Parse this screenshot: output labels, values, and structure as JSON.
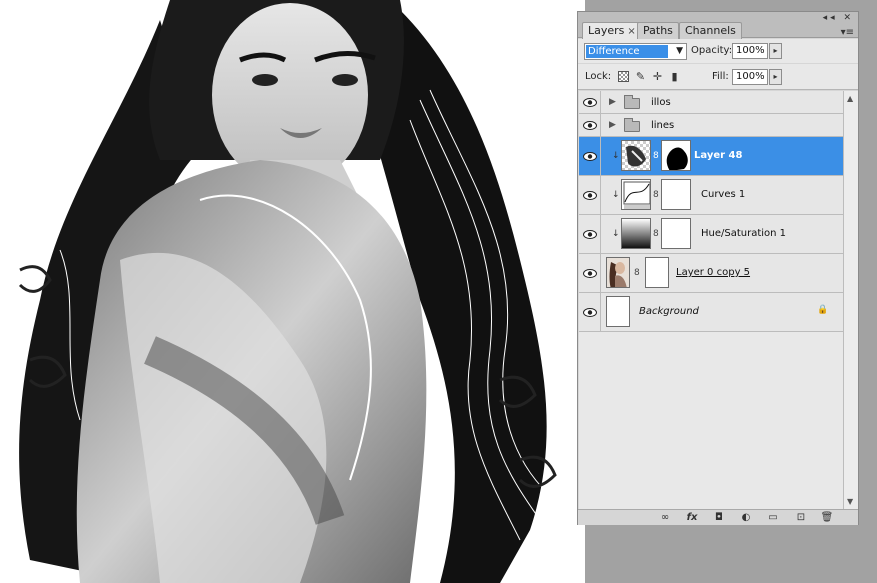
{
  "panel": {
    "tabs": [
      {
        "label": "Layers",
        "close": "×"
      },
      {
        "label": "Paths"
      },
      {
        "label": "Channels"
      }
    ],
    "window_controls": "◂◂ ✕",
    "menu_glyph": "▾≡",
    "blend_mode": "Difference",
    "opacity_label": "Opacity:",
    "opacity_value": "100%",
    "lock_label": "Lock:",
    "fill_label": "Fill:",
    "fill_value": "100%",
    "step_arrow": "▸",
    "dropdown_arrow": "▼"
  },
  "layers": [
    {
      "name": "illos",
      "kind": "group"
    },
    {
      "name": "lines",
      "kind": "group"
    },
    {
      "name": "Layer 48",
      "kind": "layer-mask",
      "selected": true
    },
    {
      "name": "Curves 1",
      "kind": "adjustment-curves"
    },
    {
      "name": "Hue/Saturation 1",
      "kind": "adjustment-hue"
    },
    {
      "name": "Layer 0 copy 5",
      "kind": "layer-mask-photo"
    },
    {
      "name": "Background",
      "kind": "background",
      "locked": true
    }
  ],
  "glyphs": {
    "expand": "▶",
    "chain": "8",
    "clip": "↓",
    "lock": "🔒",
    "scroll_up": "▲",
    "scroll_down": "▼"
  },
  "bottom_icons": [
    "link-icon",
    "fx-icon",
    "mask-icon",
    "adjustment-icon",
    "folder-icon",
    "new-layer-icon",
    "trash-icon"
  ],
  "bottom_labels": {
    "link": "∞",
    "fx": "fx",
    "mask": "◘",
    "adjust": "◐",
    "folder": "▭",
    "new": "⊡",
    "trash": "🗑"
  },
  "colors": {
    "selection": "#3b8fe6",
    "panel": "#d6d6d6",
    "app_bg": "#a2a2a2"
  }
}
